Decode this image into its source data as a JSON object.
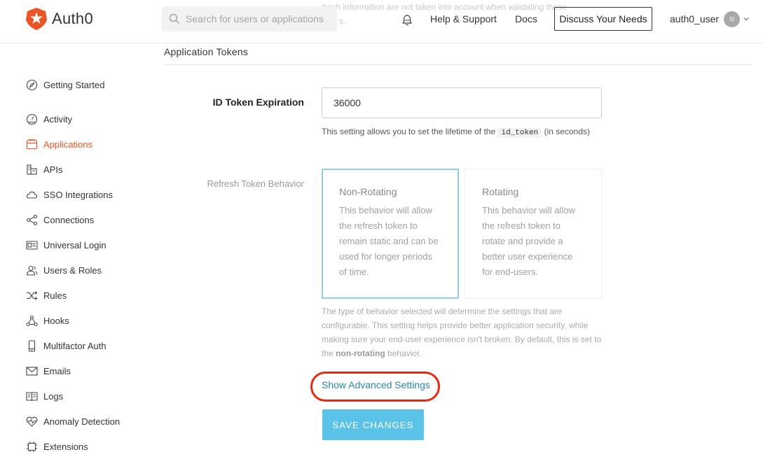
{
  "header": {
    "brand": "Auth0",
    "search_placeholder": "Search for users or applications",
    "behind_text": "hash information are not taken into account when validating these",
    "behind_text2": "s.",
    "help_label": "Help & Support",
    "docs_label": "Docs",
    "discuss_label": "Discuss Your Needs",
    "username": "auth0_user",
    "avatar_initials": "SI",
    "brand_color": "#eb5424"
  },
  "sidebar": {
    "items": [
      {
        "label": "Getting Started",
        "icon": "compass-icon"
      },
      {
        "label": "Activity",
        "icon": "activity-gauge-icon"
      },
      {
        "label": "Applications",
        "icon": "applications-icon",
        "active": true
      },
      {
        "label": "APIs",
        "icon": "apis-icon"
      },
      {
        "label": "SSO Integrations",
        "icon": "cloud-icon"
      },
      {
        "label": "Connections",
        "icon": "share-nodes-icon"
      },
      {
        "label": "Universal Login",
        "icon": "id-card-icon"
      },
      {
        "label": "Users & Roles",
        "icon": "users-icon"
      },
      {
        "label": "Rules",
        "icon": "shuffle-icon"
      },
      {
        "label": "Hooks",
        "icon": "hooks-icon"
      },
      {
        "label": "Multifactor Auth",
        "icon": "phone-icon"
      },
      {
        "label": "Emails",
        "icon": "envelope-icon"
      },
      {
        "label": "Logs",
        "icon": "book-icon"
      },
      {
        "label": "Anomaly Detection",
        "icon": "heart-pulse-icon"
      },
      {
        "label": "Extensions",
        "icon": "chip-icon"
      }
    ]
  },
  "main": {
    "section_title": "Application Tokens",
    "id_token": {
      "label": "ID Token Expiration",
      "value": "36000",
      "help_before": "This setting allows you to set the lifetime of the",
      "help_code": "id_token",
      "help_after": "(in seconds)"
    },
    "refresh": {
      "label": "Refresh Token Behavior",
      "options": [
        {
          "title": "Non-Rotating",
          "desc": "This behavior will allow the refresh token to remain static and can be used for longer periods of time.",
          "selected": true
        },
        {
          "title": "Rotating",
          "desc": "This behavior will allow the refresh token to rotate and provide a better user experience for end-users.",
          "selected": false
        }
      ],
      "note_before": "The type of behavior selected will determine the settings that are configurable. This setting helps provide better application security, while making sure your end-user experience isn't broken. By default, this is set to the",
      "note_bold": "non-rotating",
      "note_after": "behavior."
    },
    "advanced_link": "Show Advanced Settings",
    "save_label": "SAVE CHANGES",
    "accent_color": "#5bc3e8",
    "link_color": "#2a85a8",
    "highlight_color": "#e42a12"
  }
}
